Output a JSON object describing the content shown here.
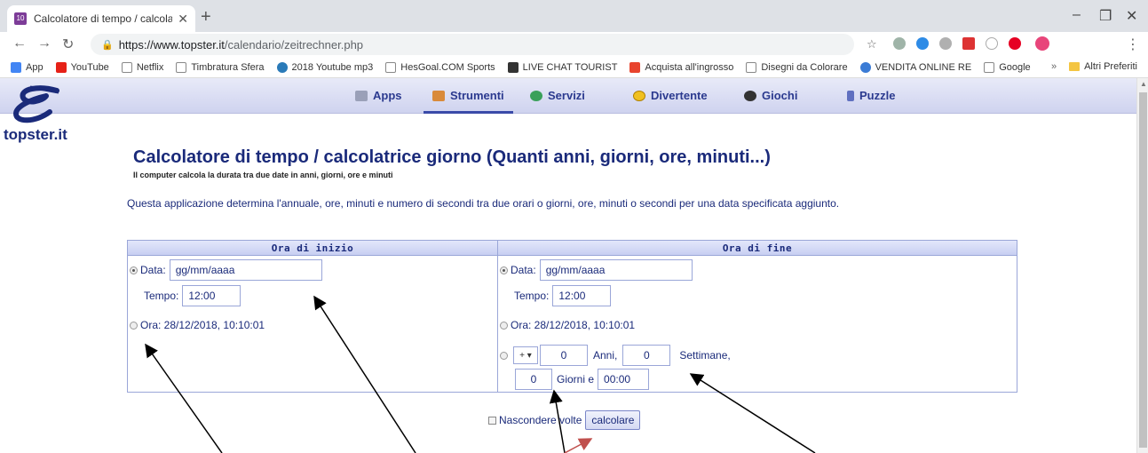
{
  "browser": {
    "tab_title": "Calcolatore di tempo / calcolatric",
    "tab_favicon": "10",
    "new_tab": "+",
    "url_host": "https://www.topster.it",
    "url_path": "/calendario/zeitrechner.php",
    "bookmarks": [
      {
        "label": "App",
        "icon": "apps-grid-icon",
        "color": "#4285f4"
      },
      {
        "label": "YouTube",
        "icon": "youtube-icon",
        "color": "#e62117"
      },
      {
        "label": "Netflix",
        "icon": "page-icon",
        "color": "#ffffff"
      },
      {
        "label": "Timbratura Sfera",
        "icon": "page-icon",
        "color": "#ffffff"
      },
      {
        "label": "2018 Youtube mp3",
        "icon": "circle-icon",
        "color": "#2a7ab8"
      },
      {
        "label": "HesGoal.COM Sports",
        "icon": "page-icon",
        "color": "#ffffff"
      },
      {
        "label": "LIVE CHAT TOURIST",
        "icon": "chat-icon",
        "color": "#333333"
      },
      {
        "label": "Acquista all'ingrosso",
        "icon": "cart-icon",
        "color": "#e8442e"
      },
      {
        "label": "Disegni da Colorare",
        "icon": "page-icon",
        "color": "#ffffff"
      },
      {
        "label": "VENDITA ONLINE RE",
        "icon": "globe-icon",
        "color": "#3a7bd5"
      },
      {
        "label": "Google",
        "icon": "page-icon",
        "color": "#ffffff"
      }
    ],
    "more_bookmarks": "»",
    "other_bookmarks": "Altri Preferiti"
  },
  "site": {
    "brand": "topster.it",
    "nav": [
      {
        "label": "Apps",
        "icon": "apps-icon",
        "color": "#9aa0b8"
      },
      {
        "label": "Strumenti",
        "icon": "tools-icon",
        "color": "#d98a3a"
      },
      {
        "label": "Servizi",
        "icon": "globe-icon",
        "color": "#3aa05a"
      },
      {
        "label": "Divertente",
        "icon": "smiley-icon",
        "color": "#f0c020"
      },
      {
        "label": "Giochi",
        "icon": "ball-icon",
        "color": "#333333"
      },
      {
        "label": "Puzzle",
        "icon": "puzzle-icon",
        "color": "#6070c0"
      }
    ],
    "active_nav": "Strumenti"
  },
  "main": {
    "title": "Calcolatore di tempo / calcolatrice giorno (Quanti anni, giorni, ore, minuti...)",
    "subtitle": "Il computer calcola la durata tra due date in anni, giorni, ore e minuti",
    "description": "Questa applicazione determina l'annuale, ore, minuti e numero di secondi tra due orari o giorni, ore, minuti o secondi per una data specificata aggiunto."
  },
  "start": {
    "header": "Ora di inizio",
    "date_label": "Data:",
    "date_value": "gg/mm/aaaa",
    "time_label": "Tempo:",
    "time_value": "12:00",
    "now_label": "Ora: 28/12/2018, 10:10:01"
  },
  "end": {
    "header": "Ora di fine",
    "date_label": "Data:",
    "date_value": "gg/mm/aaaa",
    "time_label": "Tempo:",
    "time_value": "12:00",
    "now_label": "Ora: 28/12/2018, 10:10:01",
    "sign_value": "+",
    "years_value": "0",
    "years_label": "Anni,",
    "weeks_value": "0",
    "weeks_label": "Settimane,",
    "days_value": "0",
    "days_label": "Giorni e",
    "hm_value": "00:00"
  },
  "footer": {
    "hide_label": "Nascondere volte",
    "calc_button": "calcolare"
  }
}
